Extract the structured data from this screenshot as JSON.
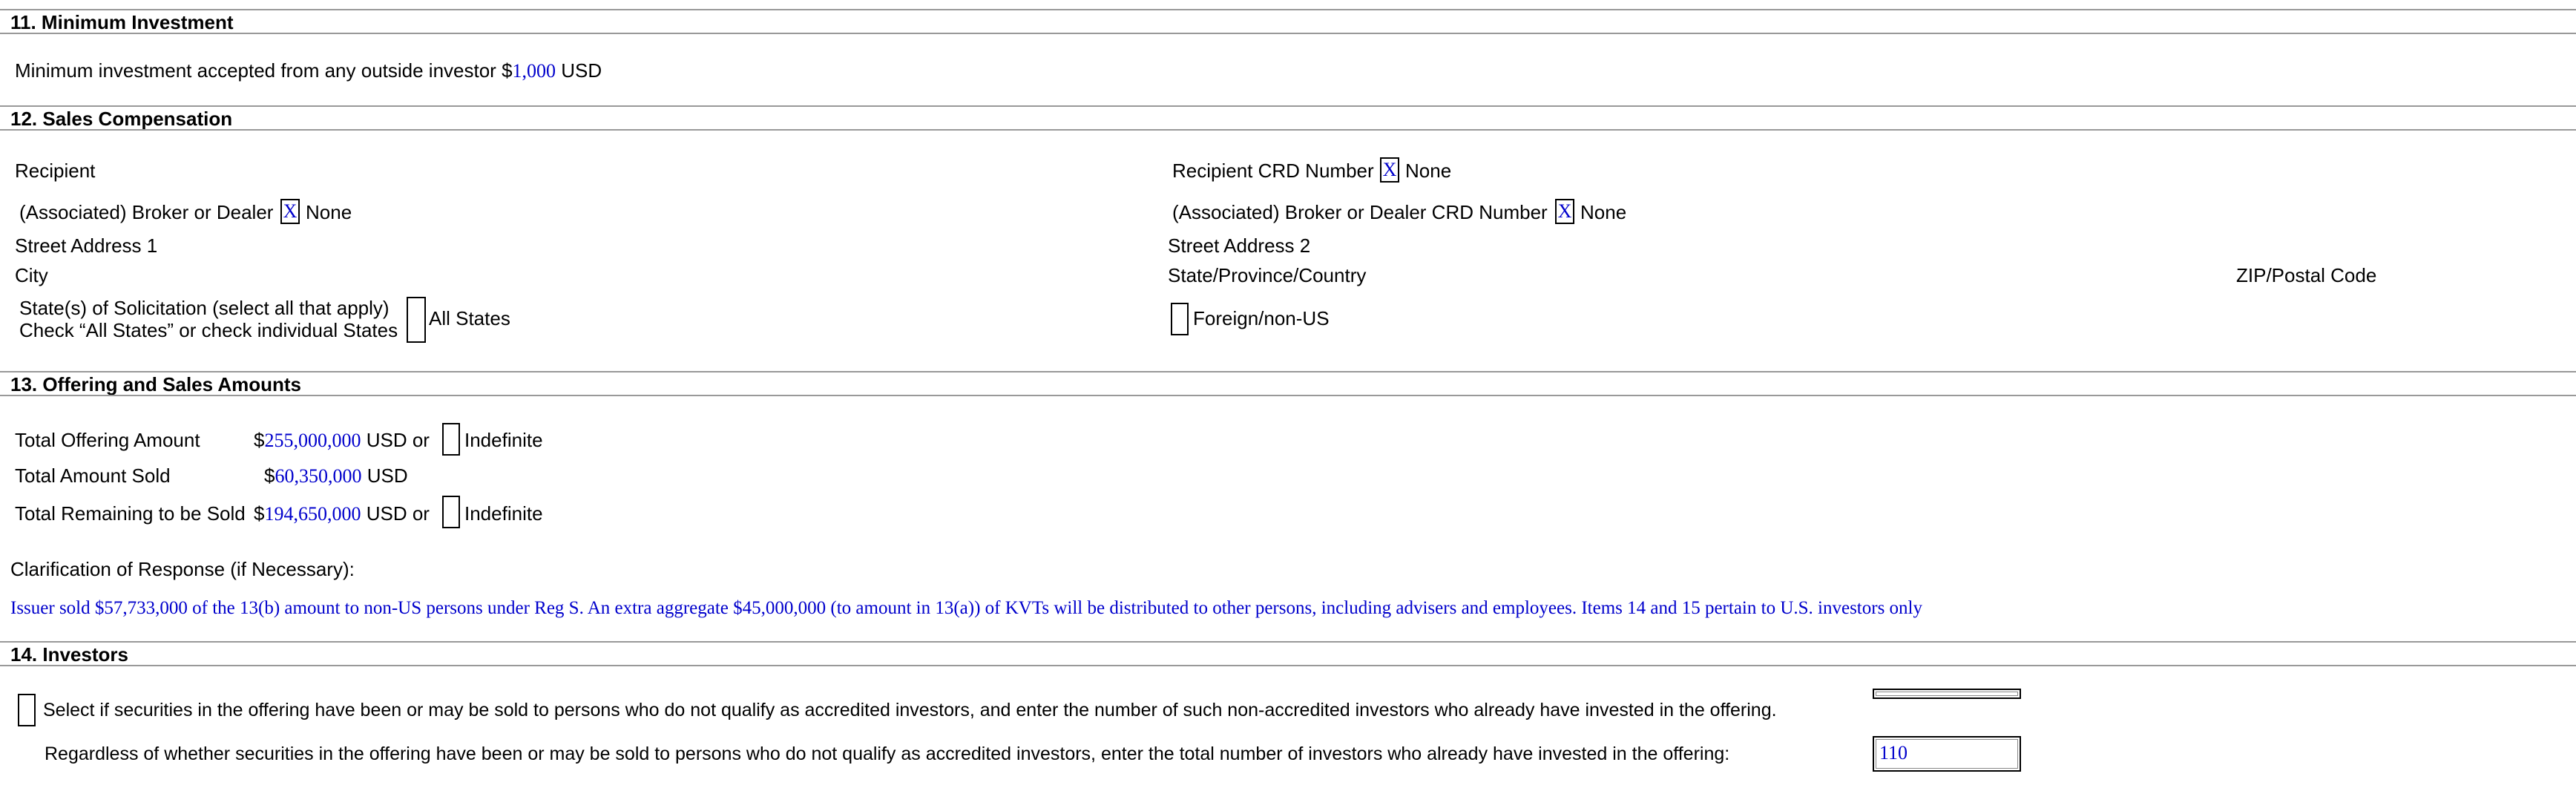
{
  "s11": {
    "title": "11. Minimum Investment",
    "label": "Minimum investment accepted from any outside investor",
    "currency_symbol": "$",
    "amount": "1,000",
    "unit": "USD"
  },
  "s12": {
    "title": "12. Sales Compensation",
    "recipient_label": "Recipient",
    "recipient_crd_label": "Recipient CRD Number",
    "recipient_crd_x": "X",
    "recipient_crd_none": "None",
    "broker_label": "(Associated) Broker or Dealer",
    "broker_x": "X",
    "broker_none": "None",
    "broker_crd_label": "(Associated) Broker or Dealer CRD Number",
    "broker_crd_x": "X",
    "broker_crd_none": "None",
    "street1_label": "Street Address 1",
    "street2_label": "Street Address 2",
    "city_label": "City",
    "state_label": "State/Province/Country",
    "zip_label": "ZIP/Postal Code",
    "solicitation_line1": "State(s) of Solicitation (select all that apply)",
    "solicitation_line2": "Check “All States” or check individual States",
    "all_states_label": "All States",
    "foreign_label": "Foreign/non-US"
  },
  "s13": {
    "title": "13. Offering and Sales Amounts",
    "total_offering_label": "Total Offering Amount",
    "total_offering_value": "255,000,000",
    "total_sold_label": "Total Amount Sold",
    "total_sold_value": "60,350,000",
    "total_remaining_label": "Total Remaining to be Sold",
    "total_remaining_value": "194,650,000",
    "currency_symbol": "$",
    "unit": "USD",
    "or_label": "or",
    "indefinite_label": "Indefinite",
    "clarification_label": "Clarification of Response (if Necessary):",
    "clarification_text": "Issuer sold $57,733,000 of the 13(b) amount to non-US persons under Reg S. An extra aggregate $45,000,000 (to amount in 13(a)) of KVTs will be distributed to other persons, including advisers and employees. Items 14 and 15 pertain to U.S. investors only"
  },
  "s14": {
    "title": "14. Investors",
    "non_accredited_label": "Select if securities in the offering have been or may be sold to persons who do not qualify as accredited investors, and enter the number of such non-accredited investors who already have invested in the offering.",
    "non_accredited_value": "",
    "total_investors_label": "Regardless of whether securities in the offering have been or may be sold to persons who do not qualify as accredited investors, enter the total number of investors who already have invested in the offering:",
    "total_investors_value": "110"
  }
}
